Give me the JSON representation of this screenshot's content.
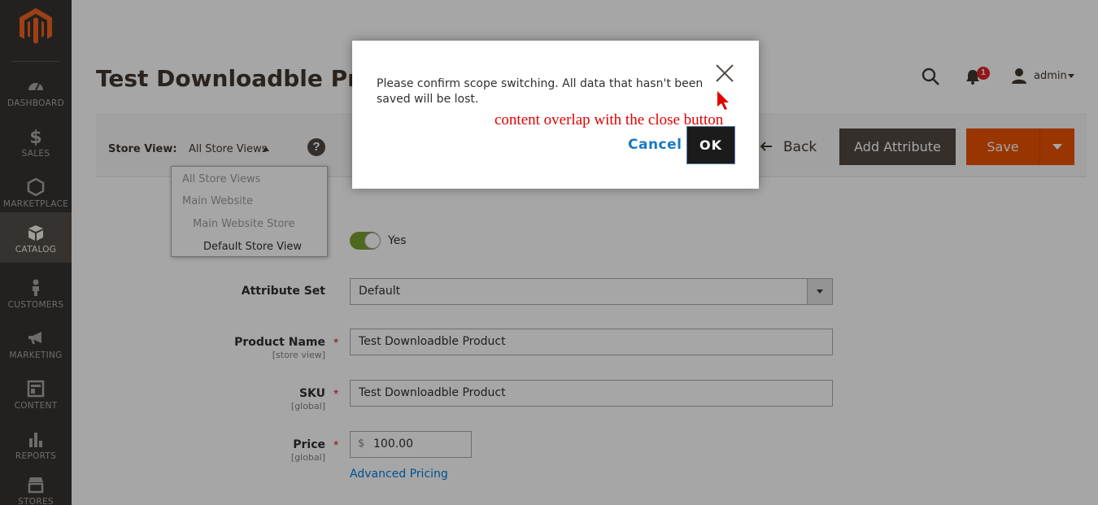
{
  "sidebar": {
    "items": [
      {
        "label": "DASHBOARD",
        "icon": "dashboard-icon"
      },
      {
        "label": "SALES",
        "icon": "dollar-icon"
      },
      {
        "label": "MARKETPLACE",
        "icon": "hexagon-icon"
      },
      {
        "label": "CATALOG",
        "icon": "box-icon",
        "active": true
      },
      {
        "label": "CUSTOMERS",
        "icon": "person-icon"
      },
      {
        "label": "MARKETING",
        "icon": "megaphone-icon"
      },
      {
        "label": "CONTENT",
        "icon": "layout-icon"
      },
      {
        "label": "REPORTS",
        "icon": "bar-chart-icon"
      },
      {
        "label": "STORES",
        "icon": "store-icon"
      }
    ]
  },
  "header": {
    "title": "Test Downloadble Produ",
    "notification_count": "1",
    "user_name": "admin"
  },
  "toolbar": {
    "store_view_label": "Store View:",
    "store_view_value": "All Store Views",
    "help_glyph": "?",
    "back_label": "Back",
    "add_attribute_label": "Add Attribute",
    "save_label": "Save"
  },
  "scope_dropdown": {
    "items": [
      "All Store Views",
      "Main Website",
      "Main Website Store",
      "Default Store View"
    ]
  },
  "form": {
    "enable_value": "Yes",
    "attribute_set_label": "Attribute Set",
    "attribute_set_value": "Default",
    "product_name_label": "Product Name",
    "product_name_scope": "[store view]",
    "product_name_value": "Test Downloadble Product",
    "sku_label": "SKU",
    "sku_scope": "[global]",
    "sku_value": "Test Downloadble Product",
    "price_label": "Price",
    "price_scope": "[global]",
    "price_currency": "$",
    "price_value": "100.00",
    "required_mark": "*",
    "advanced_pricing_link": "Advanced Pricing"
  },
  "modal": {
    "message": "Please confirm scope switching. All data that hasn't been saved will be lost.",
    "cancel_label": "Cancel",
    "ok_label": "OK",
    "annotation": "content overlap with the close button"
  },
  "colors": {
    "sidebar_bg": "#373330",
    "primary_button": "#eb5202",
    "secondary_button": "#514943",
    "link": "#007bdb",
    "annotation": "#e00000"
  }
}
